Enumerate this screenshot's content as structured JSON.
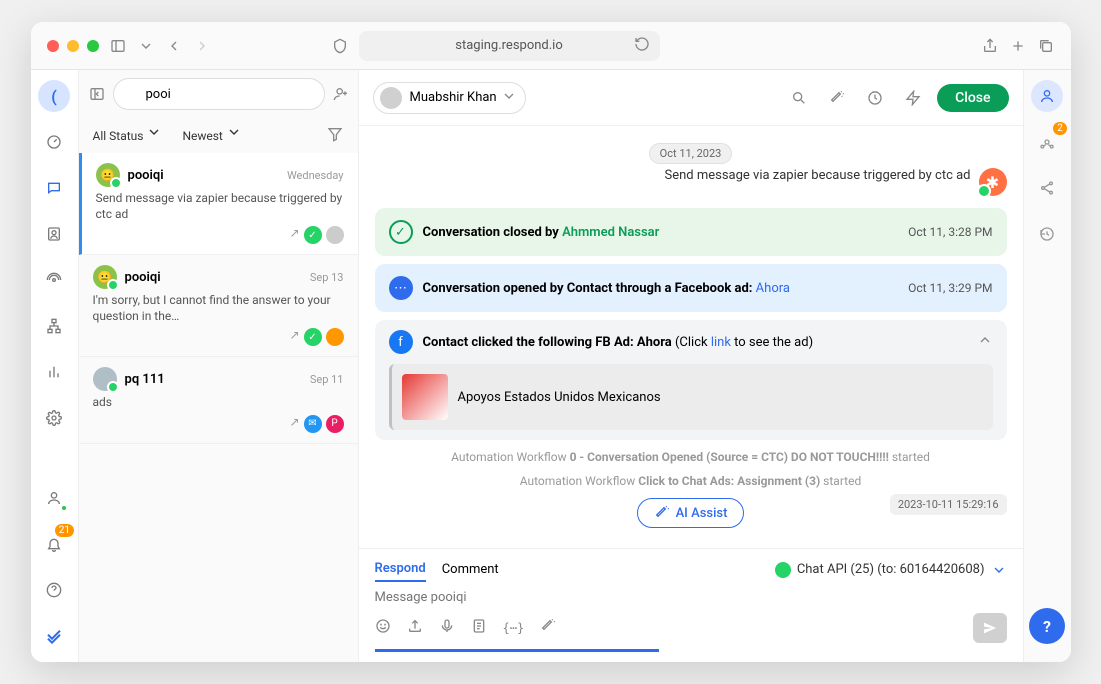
{
  "browser": {
    "url": "staging.respond.io"
  },
  "leftbar": {
    "notif_badge": "21"
  },
  "search": {
    "value": "pooi"
  },
  "filters": {
    "status": "All Status",
    "sort": "Newest"
  },
  "conversations": [
    {
      "name": "pooiqi",
      "time": "Wednesday",
      "preview": "Send message via zapier because triggered by ctc ad",
      "avatar_color": "#8bc34a"
    },
    {
      "name": "pooiqi",
      "time": "Sep 13",
      "preview": "I'm sorry, but I cannot find the answer to your question in the…",
      "avatar_color": "#8bc34a"
    },
    {
      "name": "pq 111",
      "time": "Sep 11",
      "preview": "ads",
      "avatar_color": "#b0bec5"
    }
  ],
  "header": {
    "assignee": "Muabshir Khan",
    "close_label": "Close"
  },
  "chat": {
    "date_pill": "Oct 11, 2023",
    "outbound_msg": "Send message via zapier because triggered by ctc ad",
    "event_closed_prefix": "Conversation closed by ",
    "event_closed_actor": "Ahmmed Nassar",
    "event_closed_time": "Oct 11, 3:28 PM",
    "event_opened_prefix": "Conversation opened by Contact through a Facebook ad: ",
    "event_opened_link": "Ahora",
    "event_opened_time": "Oct 11, 3:29 PM",
    "fb_head_prefix": "Contact clicked the following FB Ad: Ahora ",
    "fb_head_mid": "(Click ",
    "fb_head_link": "link",
    "fb_head_suffix": " to see the ad)",
    "fb_ad_title": "Apoyos Estados Unidos Mexicanos",
    "auto1_prefix": "Automation Workflow ",
    "auto1_bold": "0 - Conversation Opened (Source = CTC) DO NOT TOUCH!!!!",
    "auto1_suffix": " started",
    "auto2_prefix": "Automation Workflow ",
    "auto2_bold": "Click to Chat Ads: Assignment (3)",
    "auto2_suffix": " started",
    "ai_assist": "AI Assist",
    "timestamp_box": "2023-10-11 15:29:16"
  },
  "composer": {
    "tab_respond": "Respond",
    "tab_comment": "Comment",
    "channel": "Chat API (25) (to: 60164420608)",
    "placeholder": "Message pooiqi"
  },
  "rightbar": {
    "badge": "2"
  }
}
